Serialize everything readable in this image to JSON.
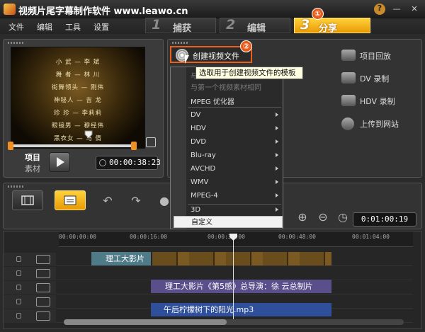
{
  "window": {
    "title": "视频片尾字幕制作软件 www.leawo.cn",
    "help_icon": "help-icon",
    "minimize": "—",
    "close": "✕"
  },
  "menu": {
    "items": [
      "文件",
      "编辑",
      "工具",
      "设置"
    ]
  },
  "steps": [
    {
      "num": "1",
      "label": "捕获"
    },
    {
      "num": "2",
      "label": "编辑"
    },
    {
      "num": "3",
      "label": "分享"
    }
  ],
  "callouts": {
    "one": "①",
    "two": "②"
  },
  "preview": {
    "credits": [
      "小 武 — 李 斌",
      "舞 者 — 林 川",
      "街舞领头 — 刚伟",
      "神秘人 — 吉 龙",
      "珍 珍 — 李莉莉",
      "眼镜男 — 穆经伟",
      "黑衣女 — 马 倩"
    ],
    "mode_project": "项目",
    "mode_clip": "素材",
    "timecode": "00:00:38:23"
  },
  "share": {
    "create_video_label": "创建视频文件",
    "tooltip": "选取用于创建视频文件的模板",
    "options": [
      {
        "icon": "project-playback-icon",
        "label": "项目回放"
      },
      {
        "icon": "dv-record-icon",
        "label": "DV 录制"
      },
      {
        "icon": "hdv-record-icon",
        "label": "HDV 录制"
      },
      {
        "icon": "globe-upload-icon",
        "label": "上传到网站"
      }
    ]
  },
  "create_menu": {
    "partial_top": "与",
    "same_as_first": "与第一个视频素材相同",
    "mpeg_optimizer": "MPEG 优化器",
    "items": [
      "DV",
      "HDV",
      "DVD",
      "Blu-ray",
      "AVCHD",
      "WMV",
      "MPEG-4",
      "3D"
    ],
    "custom": "自定义"
  },
  "timeline": {
    "ruler": [
      "00:00:00:00",
      "00:00:16:00",
      "00:00:32:00",
      "00:00:48:00",
      "00:01:04:00"
    ],
    "timecode": "0:01:00:19",
    "video_clip_label": "理工大影片",
    "title_clip_label": "理工大影片《第5感》总导演：徐 云总制片",
    "music_clip_label": "午后柠檬树下的阳光.mp3"
  }
}
